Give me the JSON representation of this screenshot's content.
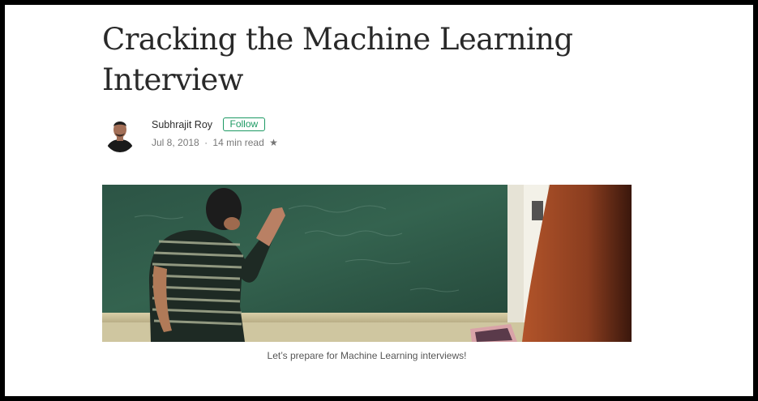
{
  "article": {
    "title": "Cracking the Machine Learning Interview",
    "author": {
      "name": "Subhrajit Roy",
      "follow_label": "Follow"
    },
    "meta": {
      "date": "Jul 8, 2018",
      "separator": "·",
      "read_time": "14 min read",
      "star": "★"
    },
    "hero_image": {
      "caption": "Let’s prepare for Machine Learning interviews!"
    }
  },
  "colors": {
    "accent": "#1c9963",
    "chalkboard": "#2f5a4a",
    "text_primary": "#222222",
    "text_secondary": "#757575"
  }
}
